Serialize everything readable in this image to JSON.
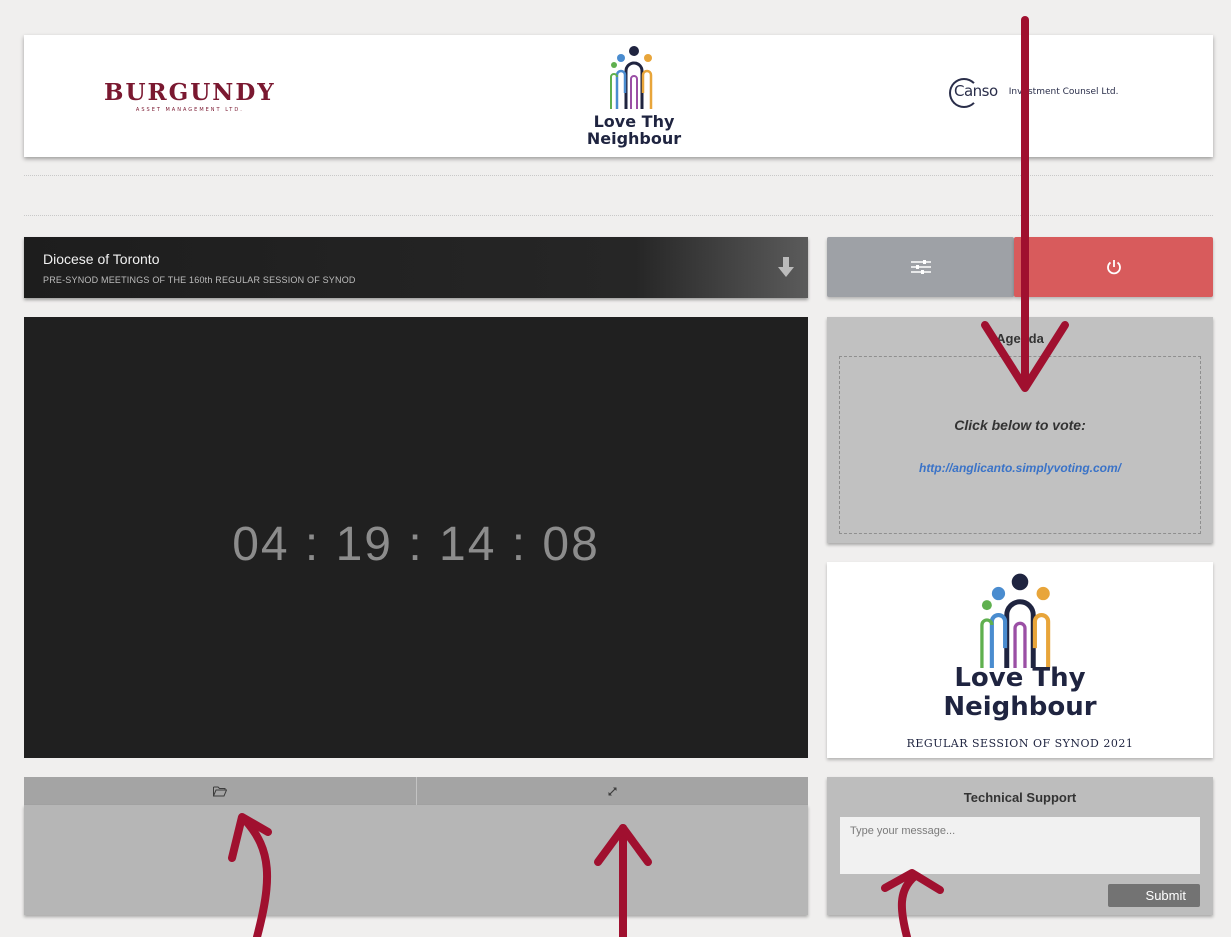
{
  "banner": {
    "burgundy_name": "BURGUNDY",
    "burgundy_tagline": "ASSET MANAGEMENT LTD.",
    "ltn_line1": "Love Thy",
    "ltn_line2": "Neighbour",
    "canso_name": "Canso",
    "canso_tagline": "Investment Counsel Ltd."
  },
  "event": {
    "organization": "Diocese of Toronto",
    "session": "PRE-SYNOD MEETINGS OF THE 160th REGULAR SESSION OF SYNOD",
    "download_icon": "arrow-down-icon"
  },
  "controls": {
    "settings_icon": "sliders-icon",
    "power_icon": "power-icon",
    "settings_color": "#9ea1a6",
    "power_color": "#d85b5c"
  },
  "player": {
    "countdown": "04 : 19 : 14 : 08"
  },
  "toolbar": {
    "folder_icon": "folder-open-icon",
    "expand_icon": "expand-icon"
  },
  "agenda": {
    "heading": "Agenda",
    "cta": "Click below to vote:",
    "link": "http://anglicanto.simplyvoting.com/",
    "link_color": "#3a73c8"
  },
  "promo": {
    "line1": "Love Thy",
    "line2": "Neighbour",
    "line3": "REGULAR SESSION OF SYNOD 2021"
  },
  "support": {
    "heading": "Technical Support",
    "placeholder": "Type your message...",
    "submit_label": "Submit"
  },
  "annotation_color": "#a0102f"
}
